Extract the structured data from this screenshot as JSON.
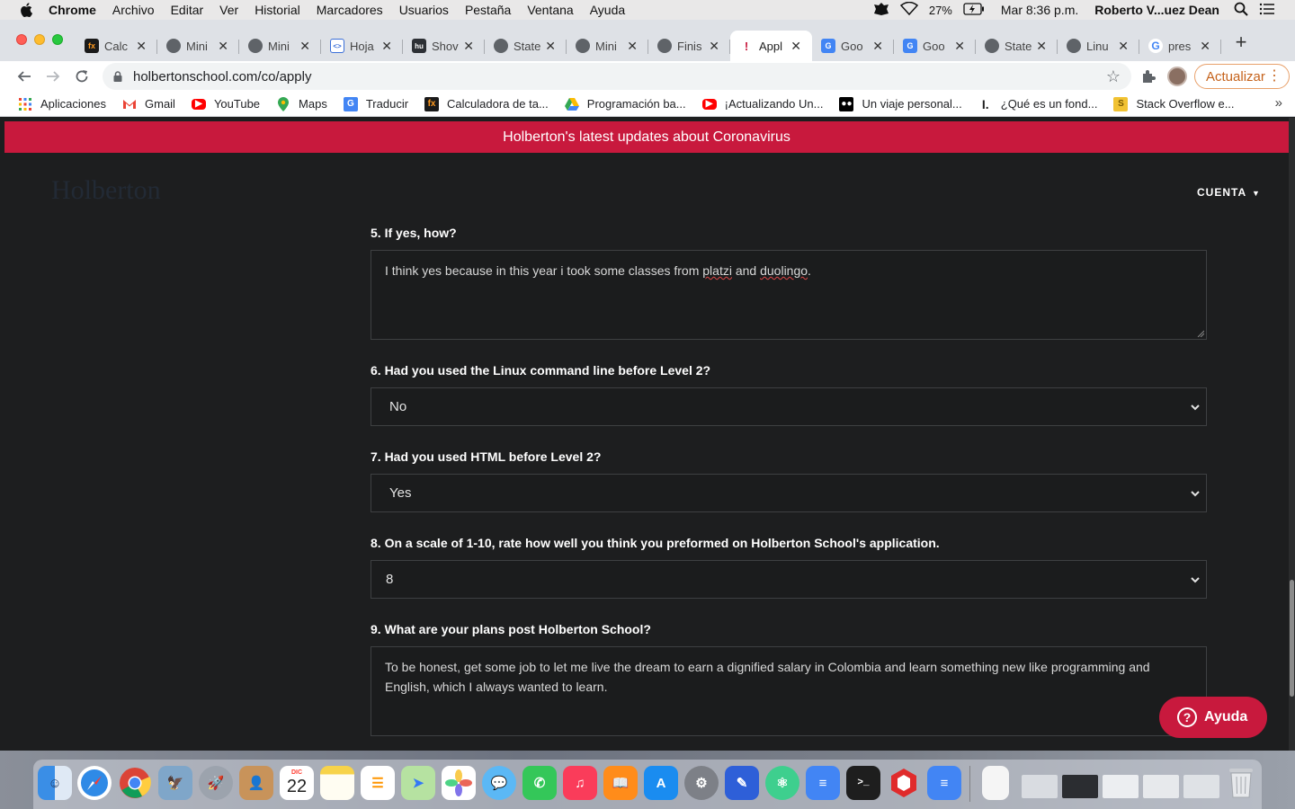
{
  "menubar": {
    "app_name": "Chrome",
    "items": [
      "Archivo",
      "Editar",
      "Ver",
      "Historial",
      "Marcadores",
      "Usuarios",
      "Pestaña",
      "Ventana",
      "Ayuda"
    ],
    "battery": "27%",
    "clock": "Mar 8:36 p.m.",
    "user": "Roberto V...uez Dean"
  },
  "tabs": [
    {
      "title": "Calc",
      "active": false
    },
    {
      "title": "Mini",
      "active": false
    },
    {
      "title": "Mini",
      "active": false
    },
    {
      "title": "Hoja",
      "active": false
    },
    {
      "title": "Shov",
      "active": false
    },
    {
      "title": "State",
      "active": false
    },
    {
      "title": "Mini",
      "active": false
    },
    {
      "title": "Finis",
      "active": false
    },
    {
      "title": "Appl",
      "active": true
    },
    {
      "title": "Goo",
      "active": false
    },
    {
      "title": "Goo",
      "active": false
    },
    {
      "title": "State",
      "active": false
    },
    {
      "title": "Linu",
      "active": false
    },
    {
      "title": "pres",
      "active": false
    }
  ],
  "address": {
    "url": "holbertonschool.com/co/apply"
  },
  "toolbar": {
    "update_label": "Actualizar"
  },
  "bookmarks": [
    {
      "label": "Aplicaciones",
      "icon": "apps-grid-icon",
      "color": "#4285f4"
    },
    {
      "label": "Gmail",
      "icon": "gmail-icon",
      "color": "#ea4335"
    },
    {
      "label": "YouTube",
      "icon": "youtube-icon",
      "color": "#ff0000"
    },
    {
      "label": "Maps",
      "icon": "maps-icon",
      "color": "#34a853"
    },
    {
      "label": "Traducir",
      "icon": "translate-icon",
      "color": "#4285f4"
    },
    {
      "label": "Calculadora de ta...",
      "icon": "fx-icon",
      "color": "#1a1a1a"
    },
    {
      "label": "Programación ba...",
      "icon": "drive-icon",
      "color": "#fbbc04"
    },
    {
      "label": "¡Actualizando Un...",
      "icon": "youtube-icon",
      "color": "#ff0000"
    },
    {
      "label": "Un viaje personal...",
      "icon": "medium-icon",
      "color": "#000000"
    },
    {
      "label": "¿Qué es un fond...",
      "icon": "site-icon",
      "color": "#222222"
    },
    {
      "label": "Stack Overflow e...",
      "icon": "stackoverflow-icon",
      "color": "#f1c232"
    }
  ],
  "page": {
    "banner": "Holberton's latest updates about Coronavirus",
    "logo": "Holberton",
    "account_menu": "CUENTA",
    "q5": {
      "label": "5. If yes, how?",
      "answer_parts": [
        "I think yes because in this year i took some classes from ",
        "platzi",
        " and ",
        "duolingo",
        "."
      ]
    },
    "q6": {
      "label": "6. Had you used the Linux command line before Level 2?",
      "value": "No"
    },
    "q7": {
      "label": "7. Had you used HTML before Level 2?",
      "value": "Yes"
    },
    "q8": {
      "label": "8. On a scale of 1-10, rate how well you think you preformed on Holberton School's application.",
      "value": "8"
    },
    "q9": {
      "label": "9. What are your plans post Holberton School?",
      "answer": "To be honest, get some job to let me live the dream to earn a dignified salary in Colombia and learn something new like programming and English, which I always wanted to learn."
    },
    "help_label": "Ayuda"
  },
  "dock": {
    "calendar_month": "DIC",
    "calendar_day": "22"
  },
  "colors": {
    "brand_red": "#c8193d",
    "page_bg": "#1d1e1f",
    "update_orange": "#c5621b"
  }
}
